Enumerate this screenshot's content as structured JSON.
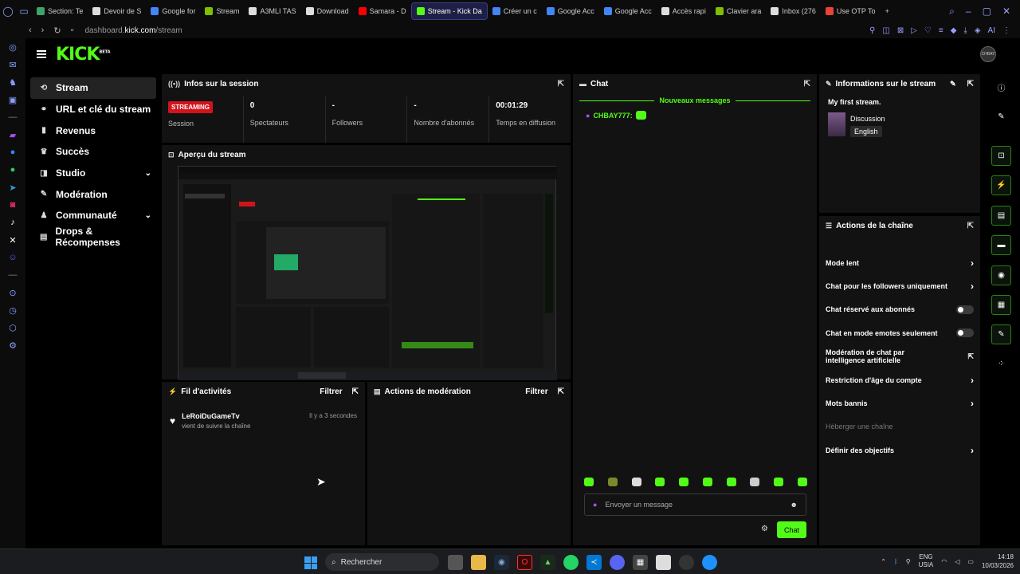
{
  "browser": {
    "tabs": [
      {
        "label": "Section: Te",
        "color": "#3fa36b"
      },
      {
        "label": "Devoir de S",
        "color": "#dddddd"
      },
      {
        "label": "Google for",
        "color": "#4285f4"
      },
      {
        "label": "Stream",
        "color": "#7ec000"
      },
      {
        "label": "A3MLI TAS",
        "color": "#dddddd"
      },
      {
        "label": "Download",
        "color": "#dddddd"
      },
      {
        "label": "Samara - D",
        "color": "#ff0000"
      },
      {
        "label": "Stream - Kick Da",
        "color": "#53fc18",
        "active": true
      },
      {
        "label": "Créer un c",
        "color": "#4285f4"
      },
      {
        "label": "Google Acc",
        "color": "#4285f4"
      },
      {
        "label": "Google Acc",
        "color": "#4285f4"
      },
      {
        "label": "Accès rapi",
        "color": "#dddddd"
      },
      {
        "label": "Clavier ara",
        "color": "#7ec000"
      },
      {
        "label": "Inbox (276",
        "color": "#dddddd"
      },
      {
        "label": "Use OTP To",
        "color": "#ea4335"
      }
    ],
    "url_prefix": "dashboard.",
    "url_domain": "kick.com",
    "url_path": "/stream",
    "ai_label": "AI"
  },
  "header": {
    "logo": "KICK",
    "logo_badge": "BETA",
    "avatar_text": "CHBAY"
  },
  "nav": [
    {
      "label": "Stream",
      "icon": "⟲",
      "active": true
    },
    {
      "label": "URL et clé du stream",
      "icon": "⚭"
    },
    {
      "label": "Revenus",
      "icon": "▮"
    },
    {
      "label": "Succès",
      "icon": "♛"
    },
    {
      "label": "Studio",
      "icon": "◨",
      "chevron": true
    },
    {
      "label": "Modération",
      "icon": "✎"
    },
    {
      "label": "Communauté",
      "icon": "♟",
      "chevron": true
    },
    {
      "label": "Drops & Récompenses",
      "icon": "▤"
    }
  ],
  "session": {
    "title": "Infos sur la session",
    "badge": "STREAMING",
    "session_label": "Session",
    "viewers_value": "0",
    "viewers_label": "Spectateurs",
    "followers_value": "-",
    "followers_label": "Followers",
    "subs_value": "-",
    "subs_label": "Nombre d'abonnés",
    "time_value": "00:01:29",
    "time_label": "Temps en diffusion"
  },
  "preview": {
    "title": "Aperçu du stream"
  },
  "activity": {
    "title": "Fil d'activités",
    "filter": "Filtrer",
    "items": [
      {
        "name": "LeRoiDuGameTv",
        "desc": "vient de suivre la chaîne",
        "time": "Il y a 3 secondes"
      }
    ]
  },
  "moderation": {
    "title": "Actions de modération",
    "filter": "Filtrer"
  },
  "chat": {
    "title": "Chat",
    "new_messages": "Nouveaux messages",
    "messages": [
      {
        "user": "CHBAY777:"
      }
    ],
    "placeholder": "Envoyer un message",
    "send": "Chat"
  },
  "stream_info": {
    "title": "Informations sur le stream",
    "stream_title": "My first stream.",
    "category": "Discussion",
    "language": "English"
  },
  "channel_actions": {
    "title": "Actions de la chaîne",
    "items": [
      {
        "label": "Mode lent",
        "type": "arrow"
      },
      {
        "label": "Chat pour les followers uniquement",
        "type": "arrow"
      },
      {
        "label": "Chat réservé aux abonnés",
        "type": "toggle"
      },
      {
        "label": "Chat en mode emotes seulement",
        "type": "toggle"
      },
      {
        "label": "Modération de chat par intelligence artificielle",
        "type": "external"
      },
      {
        "label": "Restriction d'âge du compte",
        "type": "arrow"
      },
      {
        "label": "Mots bannis",
        "type": "arrow"
      },
      {
        "label": "Héberger une chaîne",
        "type": "disabled"
      },
      {
        "label": "Définir des objectifs",
        "type": "arrow"
      }
    ]
  },
  "taskbar": {
    "search": "Rechercher",
    "lang1": "ENG",
    "lang2": "USIA",
    "time": "14:18",
    "date": "10/03/2026"
  },
  "colors": {
    "accent": "#53fc18",
    "streaming": "#d3131b",
    "panel": "#121212"
  }
}
